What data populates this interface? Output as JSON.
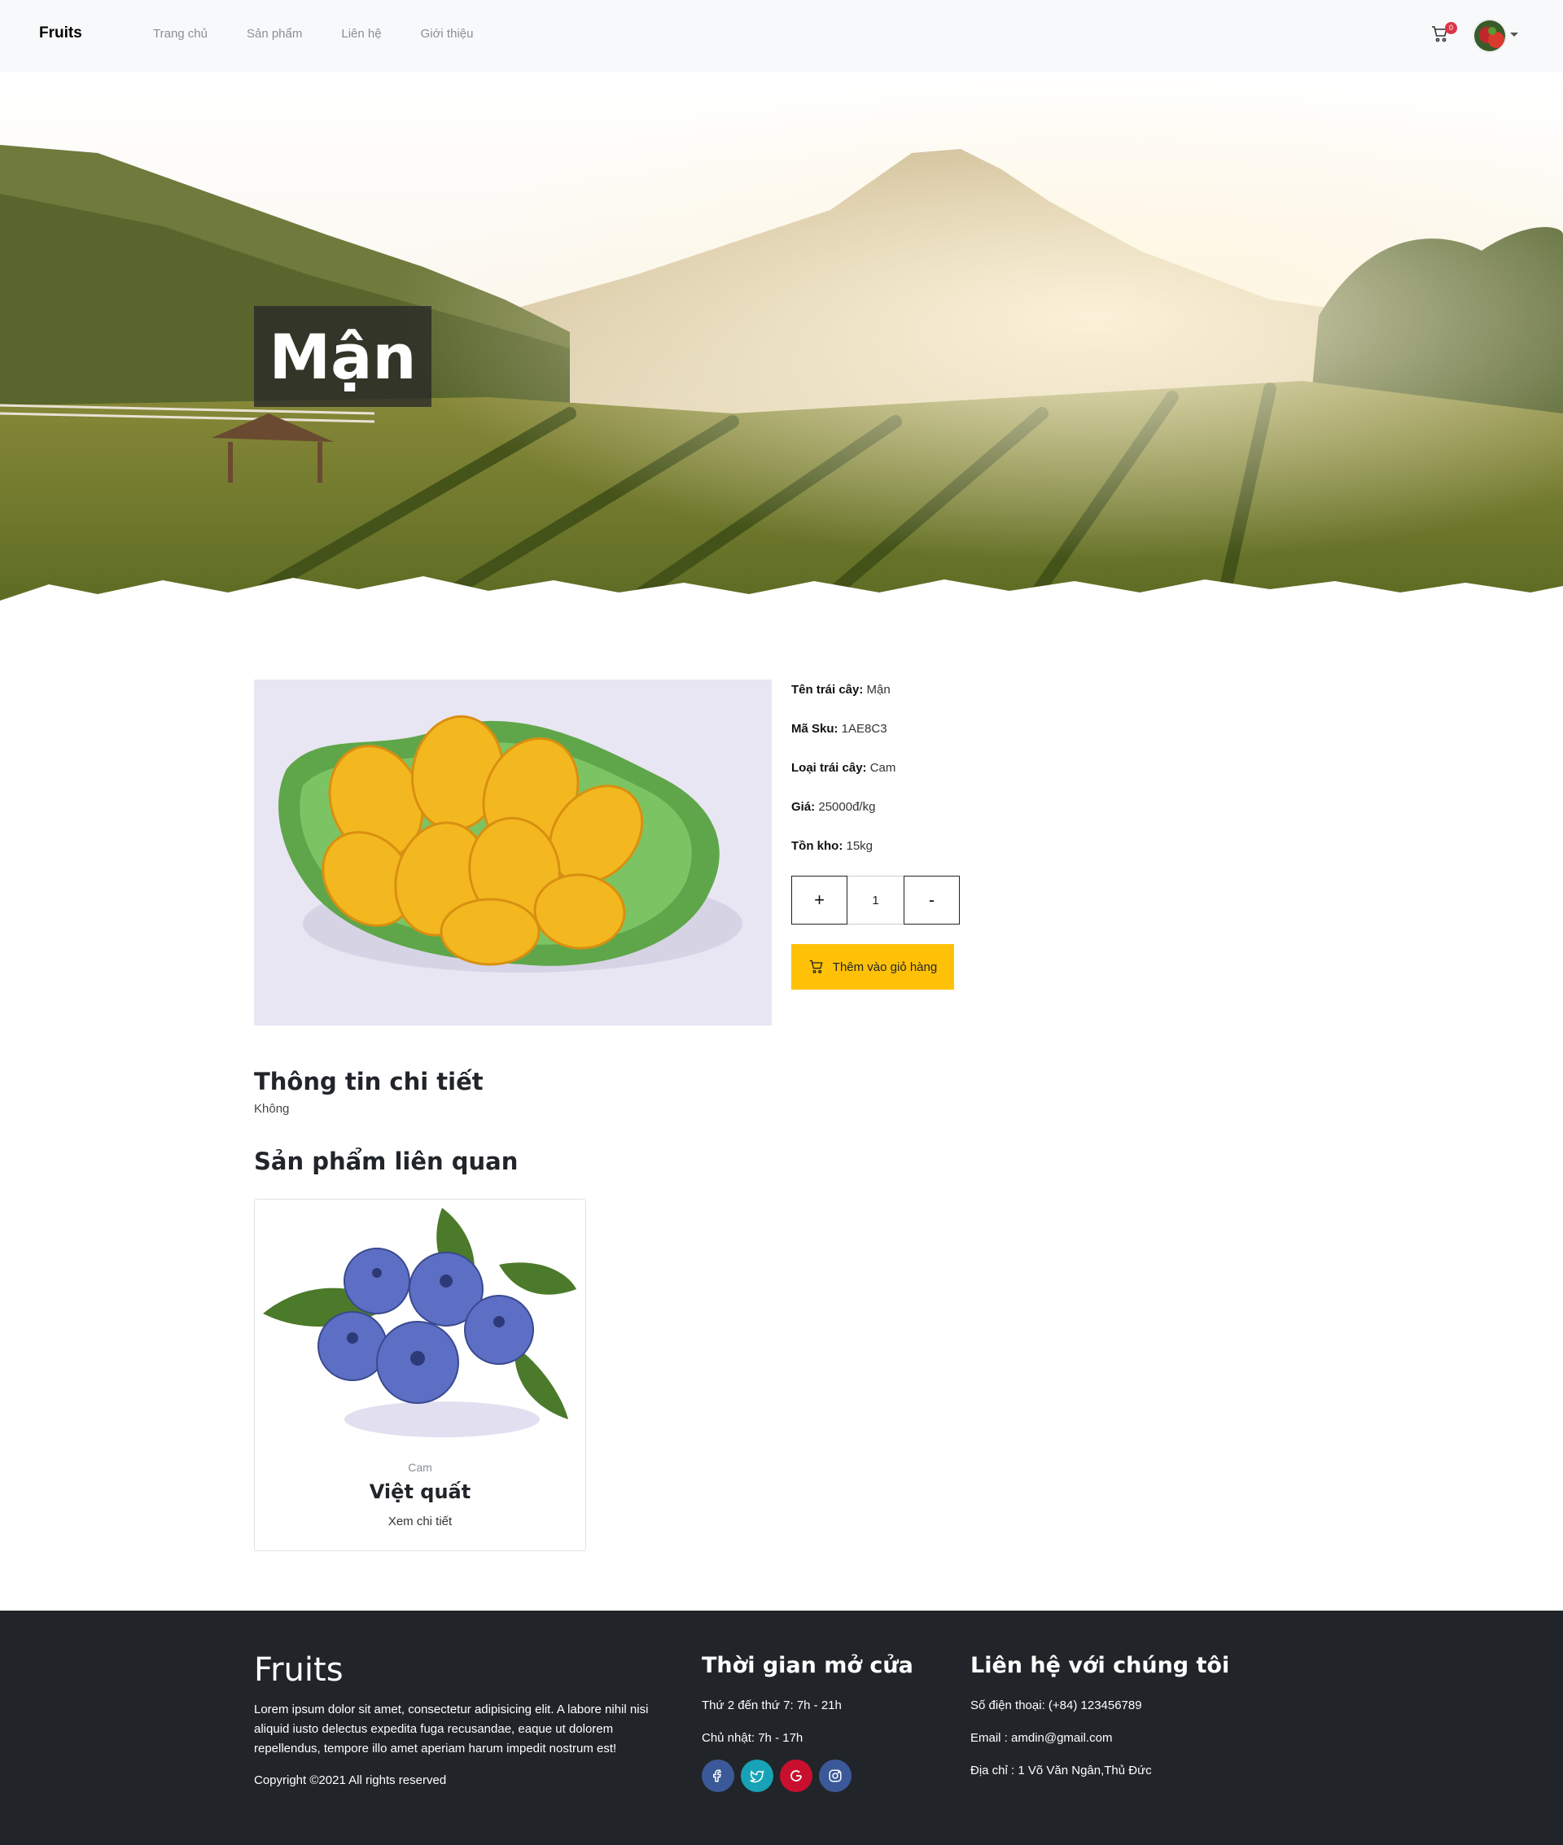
{
  "nav": {
    "brand": "Fruits",
    "links": [
      "Trang chủ",
      "Sản phẩm",
      "Liên hệ",
      "Giới thiệu"
    ],
    "cart_count": "0"
  },
  "hero": {
    "title": "Mận"
  },
  "product": {
    "name_label": "Tên trái cây:",
    "name_value": " Mận",
    "sku_label": "Mã Sku:",
    "sku_value": " 1AE8C3",
    "type_label": "Loại trái cây:",
    "type_value": " Cam",
    "price_label": "Giá:",
    "price_value": " 25000đ/kg",
    "stock_label": "Tồn kho:",
    "stock_value": " 15kg",
    "qty_plus": "+",
    "qty_value": "1",
    "qty_minus": "-",
    "add_to_cart": "Thêm vào giỏ hàng"
  },
  "details": {
    "title": "Thông tin chi tiết",
    "text": "Không"
  },
  "related": {
    "title": "Sản phẩm liên quan",
    "items": [
      {
        "category": "Cam",
        "name": "Việt quất",
        "link": "Xem chi tiết"
      }
    ]
  },
  "footer": {
    "brand": "Fruits",
    "description": "Lorem ipsum dolor sit amet, consectetur adipisicing elit. A labore nihil nisi aliquid iusto delectus expedita fuga recusandae, eaque ut dolorem repellendus, tempore illo amet aperiam harum impedit nostrum est!",
    "copyright": "Copyright ©2021 All rights reserved",
    "hours_title": "Thời gian mở cửa",
    "hours": [
      "Thứ 2 đến thứ 7: 7h - 21h",
      "Chủ nhật: 7h - 17h"
    ],
    "contact_title": "Liên hệ với chúng tôi",
    "contact": [
      "Số điện thoại: (+84) 123456789",
      "Email : amdin@gmail.com",
      "Địa chỉ : 1 Võ Văn Ngân,Thủ Đức"
    ],
    "social": [
      {
        "icon": "facebook-icon",
        "color": "#3b5998"
      },
      {
        "icon": "twitter-icon",
        "color": "#17a2b8"
      },
      {
        "icon": "google-icon",
        "color": "#c8102e"
      },
      {
        "icon": "instagram-icon",
        "color": "#3b5998"
      }
    ]
  }
}
